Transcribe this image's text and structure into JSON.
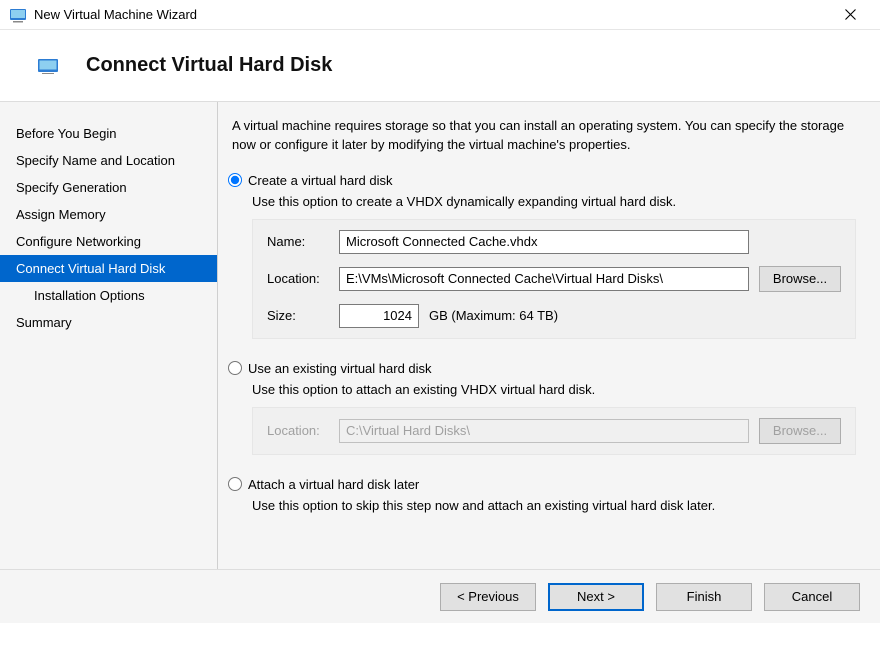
{
  "titlebar": {
    "title": "New Virtual Machine Wizard"
  },
  "header": {
    "title": "Connect Virtual Hard Disk"
  },
  "sidebar": {
    "items": [
      {
        "label": "Before You Begin"
      },
      {
        "label": "Specify Name and Location"
      },
      {
        "label": "Specify Generation"
      },
      {
        "label": "Assign Memory"
      },
      {
        "label": "Configure Networking"
      },
      {
        "label": "Connect Virtual Hard Disk"
      },
      {
        "label": "Installation Options"
      },
      {
        "label": "Summary"
      }
    ]
  },
  "intro": "A virtual machine requires storage so that you can install an operating system. You can specify the storage now or configure it later by modifying the virtual machine's properties.",
  "options": {
    "create": {
      "label": "Create a virtual hard disk",
      "desc": "Use this option to create a VHDX dynamically expanding virtual hard disk.",
      "name_label": "Name:",
      "name_value": "Microsoft Connected Cache.vhdx",
      "location_label": "Location:",
      "location_value": "E:\\VMs\\Microsoft Connected Cache\\Virtual Hard Disks\\",
      "browse_label": "Browse...",
      "size_label": "Size:",
      "size_value": "1024",
      "size_suffix": "GB (Maximum: 64 TB)"
    },
    "existing": {
      "label": "Use an existing virtual hard disk",
      "desc": "Use this option to attach an existing VHDX virtual hard disk.",
      "location_label": "Location:",
      "location_value": "C:\\Virtual Hard Disks\\",
      "browse_label": "Browse..."
    },
    "later": {
      "label": "Attach a virtual hard disk later",
      "desc": "Use this option to skip this step now and attach an existing virtual hard disk later."
    }
  },
  "footer": {
    "previous": "< Previous",
    "next": "Next >",
    "finish": "Finish",
    "cancel": "Cancel"
  }
}
